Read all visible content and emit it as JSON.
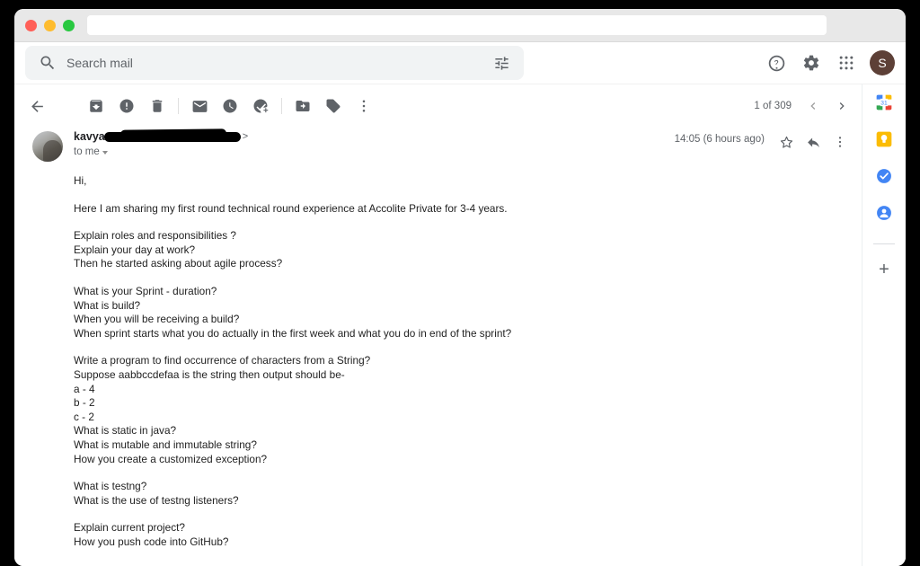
{
  "browser": {
    "url_value": "",
    "url_placeholder": ""
  },
  "gmail": {
    "search": {
      "placeholder": "Search mail",
      "value": ""
    },
    "header_icons": [
      {
        "name": "help-icon",
        "label": "Support"
      },
      {
        "name": "settings-icon",
        "label": "Settings"
      },
      {
        "name": "apps-grid-icon",
        "label": "Google apps"
      }
    ],
    "account_initial": "S",
    "account_color": "#5d4037",
    "toolbar": {
      "back_label": "Back to Inbox",
      "items": [
        {
          "name": "archive-icon",
          "label": "Archive"
        },
        {
          "name": "report-spam-icon",
          "label": "Report spam"
        },
        {
          "name": "delete-icon",
          "label": "Delete"
        },
        {
          "name": "mark-unread-icon",
          "label": "Mark as unread"
        },
        {
          "name": "snooze-icon",
          "label": "Snooze"
        },
        {
          "name": "add-to-tasks-icon",
          "label": "Add to Tasks"
        },
        {
          "name": "move-to-icon",
          "label": "Move to"
        },
        {
          "name": "labels-icon",
          "label": "Labels"
        },
        {
          "name": "more-options-icon",
          "label": "More"
        }
      ],
      "pager_text": "1 of 309",
      "prev_label": "Older",
      "next_label": "Newer"
    },
    "message": {
      "sender_name": "kavya",
      "sender_email_redacted": true,
      "email_bracket_close": ">",
      "recipient": "to me",
      "date": "14:05 (6 hours ago)",
      "actions": [
        {
          "name": "star-icon",
          "label": "Star"
        },
        {
          "name": "reply-icon",
          "label": "Reply"
        },
        {
          "name": "more-icon",
          "label": "More"
        }
      ],
      "paragraphs": [
        [
          "Hi,"
        ],
        [
          "Here I am sharing my first round technical round experience at Accolite Private for 3-4 years."
        ],
        [
          "Explain roles and responsibilities ?",
          "Explain your day at work?",
          "Then he started asking about agile process?"
        ],
        [
          "What is your Sprint - duration?",
          "What is build?",
          "When you will be receiving a build?",
          "When sprint starts what you do actually in the first week and what you do in end of the sprint?"
        ],
        [
          "Write a program to find occurrence of characters from a String?",
          "Suppose aabbccdefaa is the string then output should be-",
          "a - 4",
          "b - 2",
          "c - 2",
          "What is static in java?",
          "What is mutable and immutable string?",
          "How you create a customized exception?"
        ],
        [
          "What is testng?",
          "What is the use of testng listeners?"
        ],
        [
          "Explain current project?",
          "How you push code into GitHub?"
        ]
      ]
    },
    "right_rail": [
      {
        "name": "google-calendar-icon",
        "label": "Calendar"
      },
      {
        "name": "google-keep-icon",
        "label": "Keep"
      },
      {
        "name": "google-tasks-icon",
        "label": "Tasks"
      },
      {
        "name": "google-contacts-icon",
        "label": "Contacts"
      },
      {
        "name": "add-ons-plus-icon",
        "label": "Get Add-ons"
      }
    ]
  }
}
